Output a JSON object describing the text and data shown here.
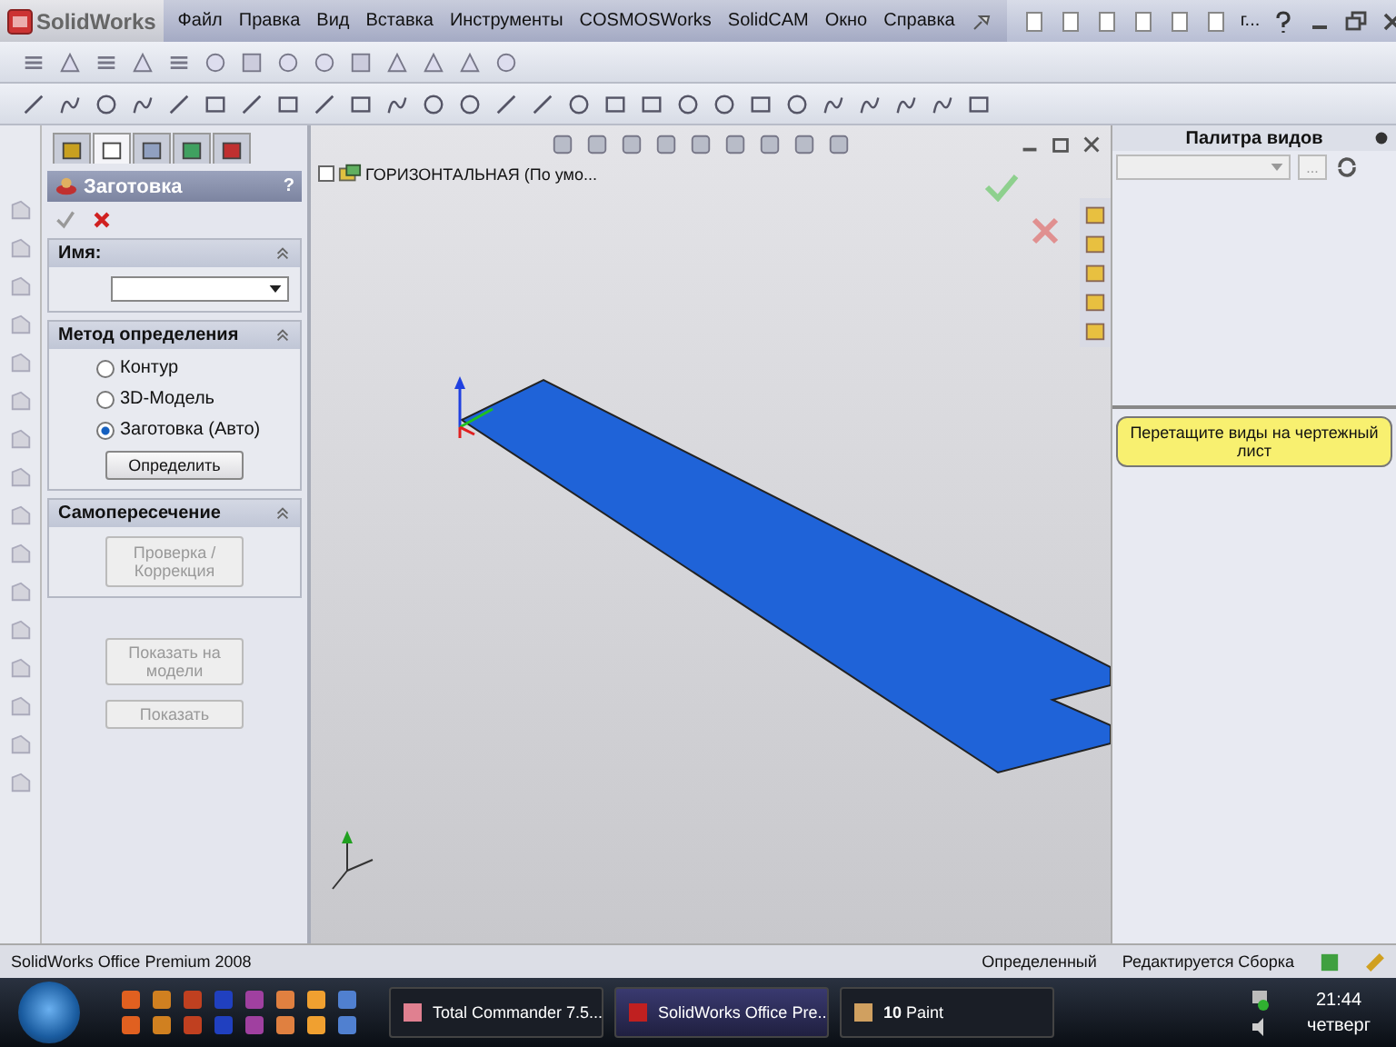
{
  "app": {
    "logo": "SolidWorks",
    "doc_title": "г..."
  },
  "menu": [
    "Файл",
    "Правка",
    "Вид",
    "Вставка",
    "Инструменты",
    "COSMOSWorks",
    "SolidCAM",
    "Окно",
    "Справка"
  ],
  "property_manager": {
    "tabs": [
      {
        "selected": false
      },
      {
        "selected": true
      },
      {
        "selected": false
      },
      {
        "selected": false
      },
      {
        "selected": false
      }
    ],
    "title": "Заготовка",
    "help": "?",
    "name_section": {
      "title": "Имя:"
    },
    "method_section": {
      "title": "Метод определения",
      "options": [
        {
          "label": "Контур",
          "selected": false
        },
        {
          "label": "3D-Модель",
          "selected": false
        },
        {
          "label": "Заготовка (Авто)",
          "selected": true
        }
      ],
      "button": {
        "label": "Определить",
        "disabled": false
      }
    },
    "intersection_section": {
      "title": "Самопересечение",
      "button": {
        "label": "Проверка / Коррекция",
        "disabled": true
      }
    },
    "buttons": [
      {
        "label": "Показать на модели",
        "disabled": true
      },
      {
        "label": "Показать",
        "disabled": true
      }
    ]
  },
  "viewport": {
    "tree_item": "ГОРИЗОНТАЛЬНАЯ  (По умо..."
  },
  "task_pane": {
    "title": "Палитра видов",
    "more_button": "...",
    "hint": "Перетащите виды на чертежный лист"
  },
  "status_bar": {
    "product": "SolidWorks Office Premium 2008",
    "state": "Определенный",
    "mode": "Редактируется Сборка"
  },
  "taskbar": {
    "windows": [
      {
        "label": "Total Commander 7.5...",
        "selected": false
      },
      {
        "label": "SolidWorks Office Pre...",
        "selected": true
      },
      {
        "label": "**10** Paint",
        "selected": false
      }
    ],
    "time": "21:44",
    "day": "четверг"
  }
}
